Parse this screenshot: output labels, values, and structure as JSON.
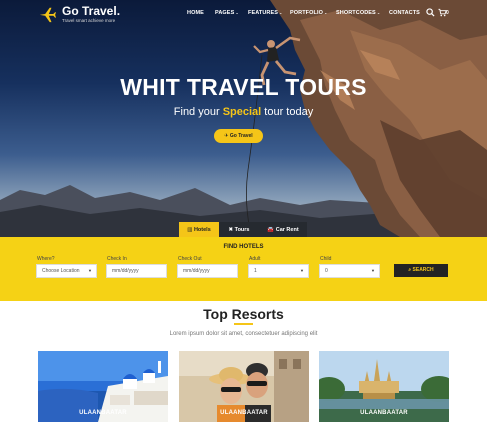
{
  "brand": {
    "name": "Go Travel.",
    "tagline": "Travel smart achieve more"
  },
  "nav": {
    "items": [
      {
        "label": "HOME",
        "caret": ""
      },
      {
        "label": "PAGES",
        "caret": "⌄"
      },
      {
        "label": "FEATURES",
        "caret": "⌄"
      },
      {
        "label": "PORTFOLIO",
        "caret": "⌄"
      },
      {
        "label": "SHORTCODES",
        "caret": "⌄"
      },
      {
        "label": "CONTACTS",
        "caret": ""
      }
    ],
    "cart_count": "0",
    "search_icon": "search-icon",
    "cart_icon": "cart-icon"
  },
  "hero": {
    "title": "WHIT TRAVEL TOURS",
    "subtitle_before": "Find your ",
    "subtitle_highlight": "Special",
    "subtitle_after": " tour today",
    "button_label": "Go Travel"
  },
  "tabs": [
    {
      "label": "Hotels",
      "icon": "building-icon",
      "glyph": "▥",
      "active": true
    },
    {
      "label": "Tours",
      "icon": "tools-icon",
      "glyph": "✖",
      "active": false
    },
    {
      "label": "Car Rent",
      "icon": "car-icon",
      "glyph": "🚘",
      "active": false
    }
  ],
  "search_form": {
    "title": "FIND HOTELS",
    "where": {
      "label": "Where?",
      "value": "Choose Location"
    },
    "check_in": {
      "label": "Check In",
      "value": "mm/dd/yyyy"
    },
    "check_out": {
      "label": "Check Out",
      "value": "mm/dd/yyyy"
    },
    "adult": {
      "label": "Adult",
      "value": "1"
    },
    "child": {
      "label": "Child",
      "value": "0"
    },
    "search_label": "SEARCH"
  },
  "resorts": {
    "title": "Top Resorts",
    "subtitle": "Lorem ipsum dolor sit amet, consectetuer adipiscing elit",
    "cards": [
      {
        "label": "ULAANBAATAR",
        "image": "santorini-photo"
      },
      {
        "label": "ULAANBAATAR",
        "image": "couple-selfie-photo"
      },
      {
        "label": "ULAANBAATAR",
        "image": "temple-photo"
      }
    ]
  },
  "colors": {
    "accent": "#f5c518",
    "dark": "#232323",
    "search_band": "#f5d215"
  }
}
